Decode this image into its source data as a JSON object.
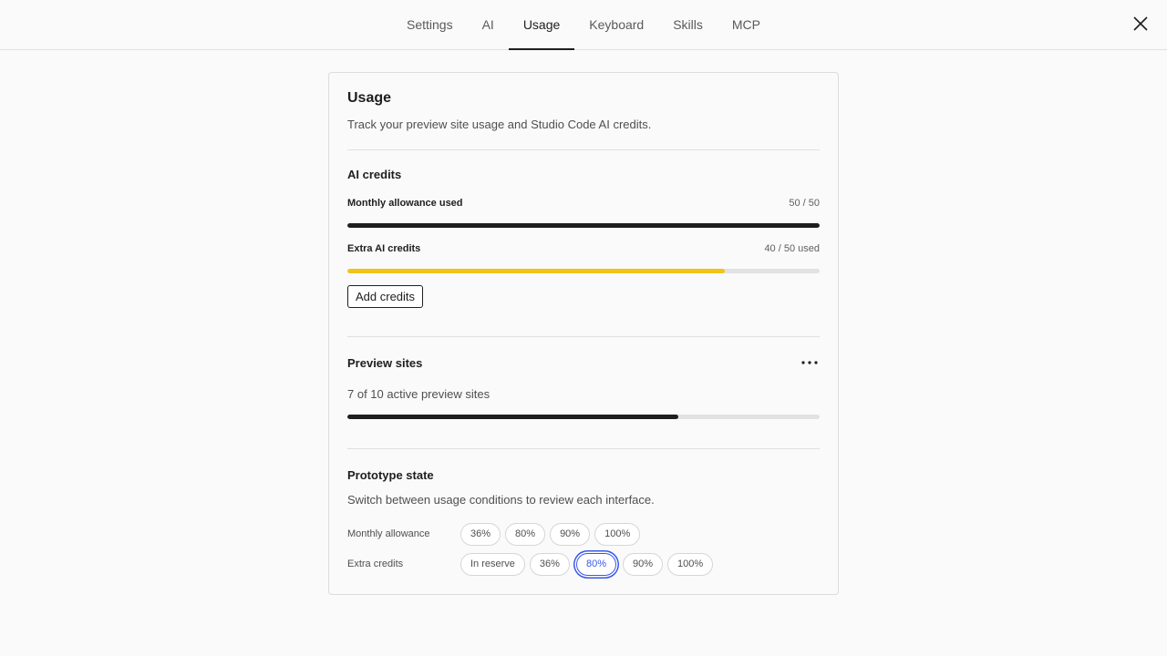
{
  "tabs": [
    {
      "label": "Settings",
      "active": false
    },
    {
      "label": "AI",
      "active": false
    },
    {
      "label": "Usage",
      "active": true
    },
    {
      "label": "Keyboard",
      "active": false
    },
    {
      "label": "Skills",
      "active": false
    },
    {
      "label": "MCP",
      "active": false
    }
  ],
  "card": {
    "title": "Usage",
    "description": "Track your preview site usage and Studio Code AI credits.",
    "ai_credits": {
      "heading": "AI credits",
      "monthly": {
        "label": "Monthly allowance used",
        "value": "50 / 50",
        "progress": 1.0,
        "color": "#1e1e1e"
      },
      "extra": {
        "label": "Extra AI credits",
        "value": "40 / 50 used",
        "progress": 0.8,
        "color": "#f0c419"
      },
      "add_button": "Add credits"
    },
    "preview_sites": {
      "heading": "Preview sites",
      "more_icon": "more-horizontal-icon",
      "summary": "7 of 10 active preview sites",
      "progress": 0.7,
      "color": "#1e1e1e"
    },
    "prototype": {
      "heading": "Prototype state",
      "description": "Switch between usage conditions to review each interface.",
      "monthly_label": "Monthly allowance",
      "monthly_options": [
        "36%",
        "80%",
        "90%",
        "100%"
      ],
      "monthly_selected": "",
      "extra_label": "Extra credits",
      "extra_options": [
        "In reserve",
        "36%",
        "80%",
        "90%",
        "100%"
      ],
      "extra_selected": "80%"
    }
  },
  "colors": {
    "accent": "#3858e9",
    "track": "#e2e2e2",
    "warning": "#f0c419"
  }
}
